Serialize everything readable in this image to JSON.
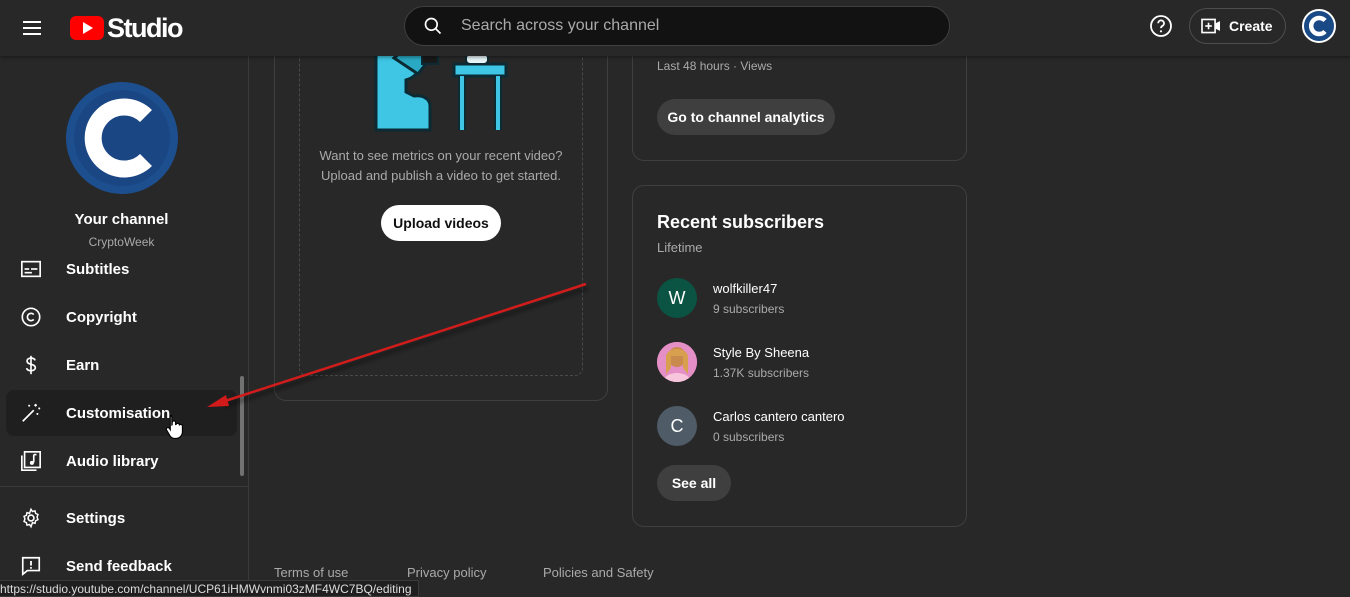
{
  "header": {
    "app_name": "Studio",
    "search_placeholder": "Search across your channel",
    "create_label": "Create"
  },
  "sidebar": {
    "channel_title": "Your channel",
    "channel_name": "CryptoWeek",
    "items": [
      {
        "label": "Subtitles",
        "icon": "subtitles-icon"
      },
      {
        "label": "Copyright",
        "icon": "copyright-icon"
      },
      {
        "label": "Earn",
        "icon": "dollar-icon"
      },
      {
        "label": "Customisation",
        "icon": "magic-wand-icon",
        "active": true
      },
      {
        "label": "Audio library",
        "icon": "music-note-icon"
      },
      {
        "label": "Settings",
        "icon": "gear-icon"
      },
      {
        "label": "Send feedback",
        "icon": "feedback-icon"
      }
    ]
  },
  "video_card": {
    "prompt_line1": "Want to see metrics on your recent video?",
    "prompt_line2": "Upload and publish a video to get started.",
    "upload_label": "Upload videos"
  },
  "analytics_card": {
    "meta": "Last 48 hours · Views",
    "button_label": "Go to channel analytics"
  },
  "subscribers_card": {
    "title": "Recent subscribers",
    "subtitle": "Lifetime",
    "items": [
      {
        "initial": "W",
        "name": "wolfkiller47",
        "count": "9 subscribers",
        "color": "#0b5443"
      },
      {
        "initial": "",
        "name": "Style By Sheena",
        "count": "1.37K subscribers",
        "color": "#e58fc7"
      },
      {
        "initial": "C",
        "name": "Carlos cantero cantero",
        "count": "0 subscribers",
        "color": "#4f5b66"
      }
    ],
    "see_all_label": "See all"
  },
  "footer": {
    "links": [
      "Terms of use",
      "Privacy policy",
      "Policies and Safety"
    ]
  },
  "status_url": "https://studio.youtube.com/channel/UCP61iHMWvnmi03zMF4WC7BQ/editing",
  "colors": {
    "background": "#282828",
    "brand_red": "#ff0000",
    "annotation_arrow": "#d11a1a"
  }
}
